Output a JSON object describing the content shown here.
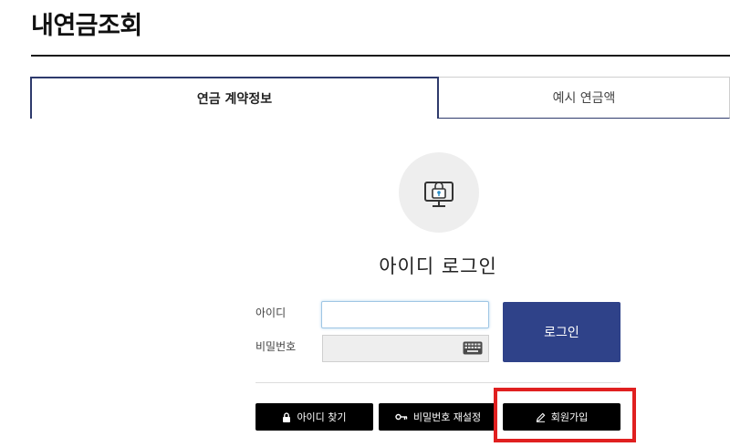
{
  "page": {
    "title": "내연금조회"
  },
  "tabs": [
    {
      "label": "연금 계약정보",
      "active": true
    },
    {
      "label": "예시 연금액",
      "active": false
    }
  ],
  "login": {
    "heading": "아이디 로그인",
    "id_label": "아이디",
    "id_value": "",
    "password_label": "비밀번호",
    "password_value": "",
    "submit_label": "로그인"
  },
  "actions": {
    "find_id_label": "아이디 찾기",
    "reset_password_label": "비밀번호 재설정",
    "signup_label": "회원가입"
  },
  "icons": {
    "lock_screen": "computer-lock-icon",
    "keyboard": "keyboard-icon",
    "find_id": "lock-icon",
    "reset_password": "key-icon",
    "signup": "pencil-icon"
  },
  "colors": {
    "accent": "#2f4289",
    "active_tab_border": "#2e3a6c",
    "highlight": "#e02020",
    "action_button": "#000000"
  }
}
